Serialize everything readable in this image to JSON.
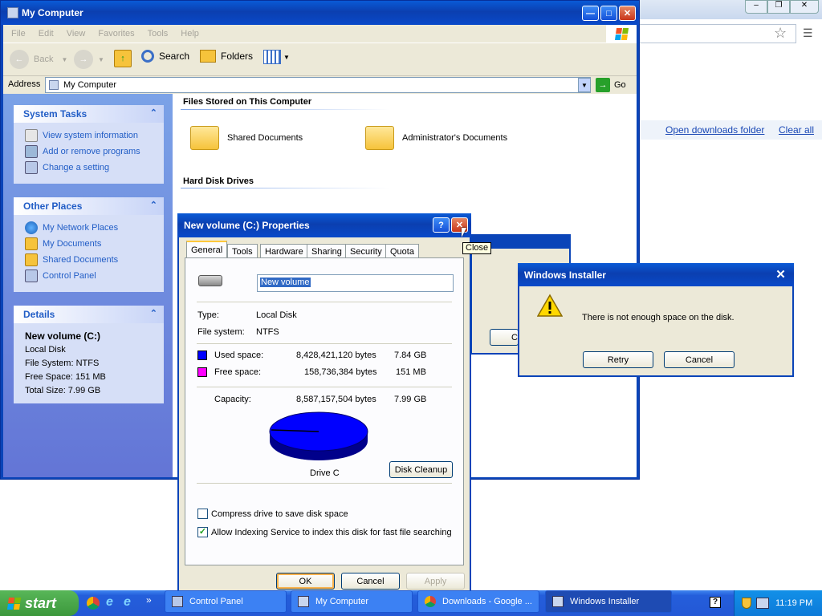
{
  "chrome_bg": {
    "open_downloads": "Open downloads folder",
    "clear_all": "Clear all"
  },
  "mycomputer": {
    "title": "My Computer",
    "menu": [
      "File",
      "Edit",
      "View",
      "Favorites",
      "Tools",
      "Help"
    ],
    "toolbar": {
      "back": "Back",
      "search": "Search",
      "folders": "Folders"
    },
    "address_label": "Address",
    "address_value": "My Computer",
    "go": "Go",
    "system_tasks": {
      "title": "System Tasks",
      "items": [
        "View system information",
        "Add or remove programs",
        "Change a setting"
      ]
    },
    "other_places": {
      "title": "Other Places",
      "items": [
        "My Network Places",
        "My Documents",
        "Shared Documents",
        "Control Panel"
      ]
    },
    "details": {
      "title": "Details",
      "name": "New volume (C:)",
      "lines": [
        "Local Disk",
        "File System: NTFS",
        "Free Space: 151 MB",
        "Total Size: 7.99 GB"
      ]
    },
    "section_files": "Files Stored on This Computer",
    "files": [
      "Shared Documents",
      "Administrator's Documents"
    ],
    "section_disks": "Hard Disk Drives"
  },
  "properties": {
    "title": "New volume (C:) Properties",
    "help": "?",
    "tooltip": "Close",
    "tabs": [
      "General",
      "Tools",
      "Hardware",
      "Sharing",
      "Security",
      "Quota"
    ],
    "volume_name": "New volume",
    "type_label": "Type:",
    "type_value": "Local Disk",
    "fs_label": "File system:",
    "fs_value": "NTFS",
    "used_label": "Used space:",
    "used_bytes": "8,428,421,120 bytes",
    "used_size": "7.84 GB",
    "free_label": "Free space:",
    "free_bytes": "158,736,384 bytes",
    "free_size": "151 MB",
    "cap_label": "Capacity:",
    "cap_bytes": "8,587,157,504 bytes",
    "cap_size": "7.99 GB",
    "drive_label": "Drive C",
    "disk_cleanup": "Disk Cleanup",
    "compress": "Compress drive to save disk space",
    "indexing": "Allow Indexing Service to index this disk for fast file searching",
    "indexing_checked": true,
    "ok": "OK",
    "cancel": "Cancel",
    "apply": "Apply",
    "colors": {
      "used": "#0000ff",
      "free": "#ff00ff"
    }
  },
  "behind_dialog": {
    "btn": "C"
  },
  "installer": {
    "title": "Windows Installer",
    "message": "There is not enough space on the disk.",
    "retry": "Retry",
    "cancel": "Cancel"
  },
  "taskbar": {
    "start": "start",
    "buttons": [
      "Control Panel",
      "My Computer",
      "Downloads - Google ...",
      "Windows Installer"
    ],
    "chevron": "»",
    "time": "11:19 PM"
  }
}
